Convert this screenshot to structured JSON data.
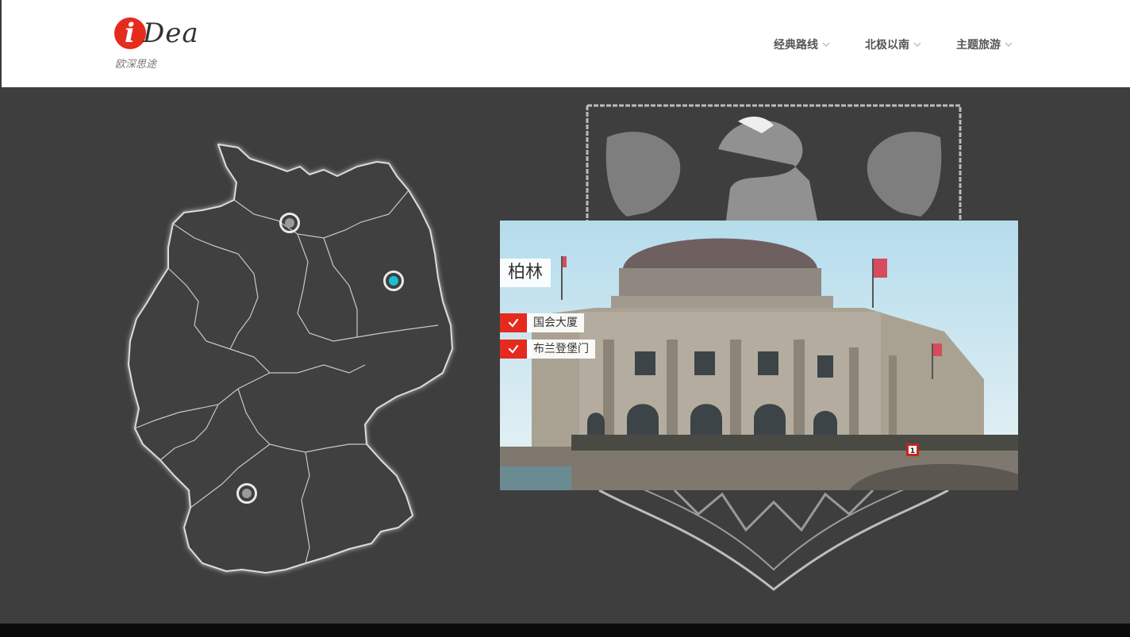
{
  "brand": {
    "logo_letter": "i",
    "logo_rest": "Dea",
    "subtitle": "欧深思途"
  },
  "nav": [
    {
      "label": "经典路线",
      "icon": "chevron-down-icon"
    },
    {
      "label": "北极以南",
      "icon": "chevron-down-icon"
    },
    {
      "label": "主题旅游",
      "icon": "chevron-down-icon"
    }
  ],
  "map": {
    "region": "Germany",
    "pins": [
      {
        "name": "hamburg",
        "active": false
      },
      {
        "name": "berlin",
        "active": true
      },
      {
        "name": "stuttgart",
        "active": false
      }
    ]
  },
  "card": {
    "city": "柏林",
    "attractions": [
      {
        "label": "国会大厦",
        "checked": true
      },
      {
        "label": "布兰登堡门",
        "checked": true
      }
    ],
    "photo_sign": "1"
  },
  "colors": {
    "accent_red": "#e52b1e",
    "active_pin": "#16c1d8",
    "background": "#3e3e3e",
    "header": "#ffffff"
  }
}
